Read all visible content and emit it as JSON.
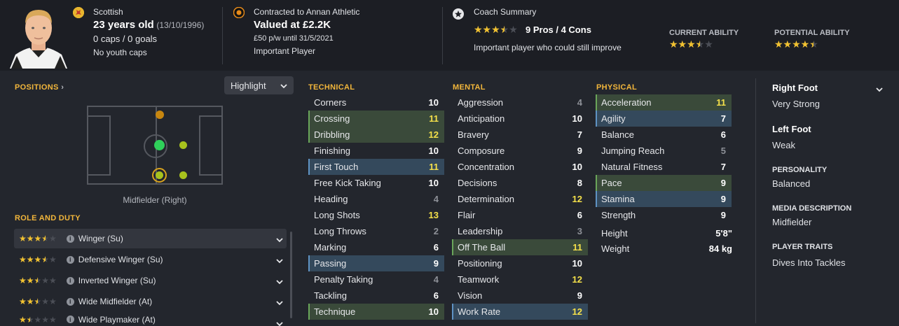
{
  "player": {
    "nationality": "Scottish",
    "age": "23 years old",
    "dob": "(13/10/1996)",
    "caps": "0 caps / 0 goals",
    "youth_caps": "No youth caps"
  },
  "contract": {
    "club_line": "Contracted to Annan Athletic",
    "value": "Valued at £2.2K",
    "wage": "£50 p/w until 31/5/2021",
    "status": "Important Player"
  },
  "coach": {
    "title": "Coach Summary",
    "stars": 3.5,
    "pros_cons": "9 Pros / 4 Cons",
    "summary": "Important player who could still improve",
    "current_ability_label": "CURRENT ABILITY",
    "current_ability_stars": 3.5,
    "potential_ability_label": "POTENTIAL ABILITY",
    "potential_ability_stars": 4.5
  },
  "positions": {
    "title": "POSITIONS",
    "highlight_label": "Highlight",
    "position_label": "Midfielder (Right)"
  },
  "roles": {
    "title": "ROLE AND DUTY",
    "items": [
      {
        "name": "Winger (Su)",
        "stars": 3.5
      },
      {
        "name": "Defensive Winger (Su)",
        "stars": 3.5
      },
      {
        "name": "Inverted Winger (Su)",
        "stars": 2.5
      },
      {
        "name": "Wide Midfielder (At)",
        "stars": 2.5
      },
      {
        "name": "Wide Playmaker (At)",
        "stars": 1.5
      }
    ]
  },
  "technical": {
    "title": "TECHNICAL",
    "rows": [
      {
        "name": "Corners",
        "value": "10",
        "hl": "",
        "tone": "white"
      },
      {
        "name": "Crossing",
        "value": "11",
        "hl": "green",
        "tone": "yellow"
      },
      {
        "name": "Dribbling",
        "value": "12",
        "hl": "green",
        "tone": "yellow"
      },
      {
        "name": "Finishing",
        "value": "10",
        "hl": "",
        "tone": "white"
      },
      {
        "name": "First Touch",
        "value": "11",
        "hl": "blue",
        "tone": "yellow"
      },
      {
        "name": "Free Kick Taking",
        "value": "10",
        "hl": "",
        "tone": "white"
      },
      {
        "name": "Heading",
        "value": "4",
        "hl": "",
        "tone": "gray"
      },
      {
        "name": "Long Shots",
        "value": "13",
        "hl": "",
        "tone": "yellow"
      },
      {
        "name": "Long Throws",
        "value": "2",
        "hl": "",
        "tone": "gray"
      },
      {
        "name": "Marking",
        "value": "6",
        "hl": "",
        "tone": "white"
      },
      {
        "name": "Passing",
        "value": "9",
        "hl": "blue",
        "tone": "white"
      },
      {
        "name": "Penalty Taking",
        "value": "4",
        "hl": "",
        "tone": "gray"
      },
      {
        "name": "Tackling",
        "value": "6",
        "hl": "",
        "tone": "white"
      },
      {
        "name": "Technique",
        "value": "10",
        "hl": "green",
        "tone": "white"
      }
    ]
  },
  "mental": {
    "title": "MENTAL",
    "rows": [
      {
        "name": "Aggression",
        "value": "4",
        "hl": "",
        "tone": "gray"
      },
      {
        "name": "Anticipation",
        "value": "10",
        "hl": "",
        "tone": "white"
      },
      {
        "name": "Bravery",
        "value": "7",
        "hl": "",
        "tone": "white"
      },
      {
        "name": "Composure",
        "value": "9",
        "hl": "",
        "tone": "white"
      },
      {
        "name": "Concentration",
        "value": "10",
        "hl": "",
        "tone": "white"
      },
      {
        "name": "Decisions",
        "value": "8",
        "hl": "",
        "tone": "white"
      },
      {
        "name": "Determination",
        "value": "12",
        "hl": "",
        "tone": "yellow"
      },
      {
        "name": "Flair",
        "value": "6",
        "hl": "",
        "tone": "white"
      },
      {
        "name": "Leadership",
        "value": "3",
        "hl": "",
        "tone": "gray"
      },
      {
        "name": "Off The Ball",
        "value": "11",
        "hl": "green",
        "tone": "yellow"
      },
      {
        "name": "Positioning",
        "value": "10",
        "hl": "",
        "tone": "white"
      },
      {
        "name": "Teamwork",
        "value": "12",
        "hl": "",
        "tone": "yellow"
      },
      {
        "name": "Vision",
        "value": "9",
        "hl": "",
        "tone": "white"
      },
      {
        "name": "Work Rate",
        "value": "12",
        "hl": "blue",
        "tone": "yellow"
      }
    ]
  },
  "physical": {
    "title": "PHYSICAL",
    "rows": [
      {
        "name": "Acceleration",
        "value": "11",
        "hl": "green",
        "tone": "yellow"
      },
      {
        "name": "Agility",
        "value": "7",
        "hl": "blue",
        "tone": "white"
      },
      {
        "name": "Balance",
        "value": "6",
        "hl": "",
        "tone": "white"
      },
      {
        "name": "Jumping Reach",
        "value": "5",
        "hl": "",
        "tone": "gray"
      },
      {
        "name": "Natural Fitness",
        "value": "7",
        "hl": "",
        "tone": "white"
      },
      {
        "name": "Pace",
        "value": "9",
        "hl": "green",
        "tone": "white"
      },
      {
        "name": "Stamina",
        "value": "9",
        "hl": "blue",
        "tone": "white"
      },
      {
        "name": "Strength",
        "value": "9",
        "hl": "",
        "tone": "white"
      }
    ],
    "height_label": "Height",
    "height_value": "5'8\"",
    "weight_label": "Weight",
    "weight_value": "84 kg"
  },
  "side": {
    "foot1_label": "Right Foot",
    "foot1_value": "Very Strong",
    "foot2_label": "Left Foot",
    "foot2_value": "Weak",
    "personality_label": "PERSONALITY",
    "personality_value": "Balanced",
    "media_label": "MEDIA DESCRIPTION",
    "media_value": "Midfielder",
    "traits_label": "PLAYER TRAITS",
    "traits_value": "Dives Into Tackles"
  },
  "colors": {
    "accent": "#f2b63b",
    "star": "#f2c230",
    "highlight_green": "#3a4a3a",
    "highlight_blue": "#34495c",
    "value_yellow": "#f4e04a"
  }
}
